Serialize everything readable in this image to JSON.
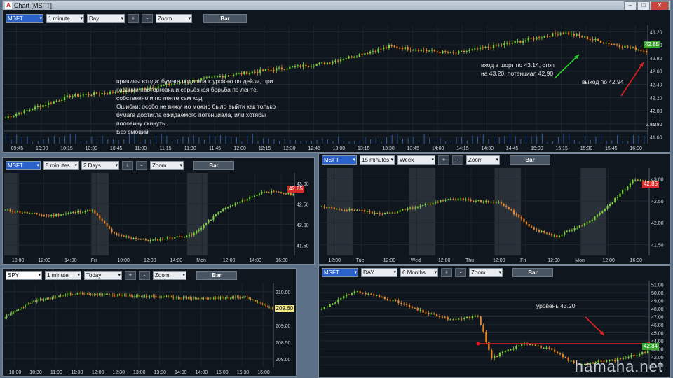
{
  "main": {
    "title": "Chart [MSFT]",
    "symbol": "MSFT",
    "interval": "1 minute",
    "range": "Day",
    "zoom": "Zoom",
    "bar_label": "Bar",
    "plus": "+",
    "minus": "-",
    "price_badge": "42.85",
    "volume_label": "2.8M",
    "y_ticks": [
      "43.20",
      "43.00",
      "42.80",
      "42.60",
      "42.40",
      "42.20",
      "42.00",
      "41.80",
      "41.60"
    ],
    "x_ticks": [
      "09:45",
      "10:00",
      "10:15",
      "10:30",
      "10:45",
      "11:00",
      "11:15",
      "11:30",
      "11:45",
      "12:00",
      "12:15",
      "12:30",
      "12:45",
      "13:00",
      "13:15",
      "13:30",
      "13:45",
      "14:00",
      "14:15",
      "14:30",
      "14:45",
      "15:00",
      "15:15",
      "15:30",
      "15:45",
      "16:00"
    ],
    "annotation_reasons": "причины входа: бумага подошла к уровню по дейли, при\nкасании проторговка и серьёзная борьба по ленте,\nсобственно и по ленте сам ход\nОшибки: особо не вижу, но можно было выйти как только\nбумага достигла ожидаемого потенциала, или хотябы\nполовину скинуть.\nБез эмоций",
    "annotation_entry": "вход в шорт по 43.14, стоп\nна 43.20, потенциал 42.90",
    "annotation_exit": "выход по 42.94",
    "colors": {
      "entry_arrow": "#2bd12b",
      "exit_arrow": "#e02020",
      "up": "#7bd23a",
      "down": "#e8862a"
    }
  },
  "chart_5min": {
    "symbol": "MSFT",
    "interval": "5 minutes",
    "range": "2 Days",
    "zoom": "Zoom",
    "bar_label": "Bar",
    "plus": "+",
    "minus": "-",
    "price_badge": "42.85",
    "y_ticks": [
      "43.00",
      "42.50",
      "42.00",
      "41.50"
    ],
    "x_ticks": [
      "10:00",
      "12:00",
      "14:00",
      "Fri",
      "10:00",
      "12:00",
      "14:00",
      "Mon",
      "12:00",
      "14:00",
      "16:00"
    ]
  },
  "chart_15min": {
    "symbol": "MSFT",
    "interval": "15 minutes",
    "range": "Week",
    "zoom": "Zoom",
    "bar_label": "Bar",
    "plus": "+",
    "minus": "-",
    "price_badge": "42.85",
    "y_ticks": [
      "43.00",
      "42.50",
      "42.00",
      "41.50"
    ],
    "x_ticks": [
      "12:00",
      "Tue",
      "12:00",
      "Wed",
      "12:00",
      "Thu",
      "12:00",
      "Fri",
      "12:00",
      "Mon",
      "12:00",
      "16:00"
    ]
  },
  "chart_spy": {
    "symbol": "SPY",
    "interval": "1 minute",
    "range": "Today",
    "zoom": "Zoom",
    "bar_label": "Bar",
    "plus": "+",
    "minus": "-",
    "price_badge": "209.60",
    "y_ticks": [
      "210.00",
      "209.50",
      "209.00",
      "208.50",
      "208.00"
    ],
    "x_ticks": [
      "10:00",
      "10:30",
      "11:00",
      "11:30",
      "12:00",
      "12:30",
      "13:00",
      "13:30",
      "14:00",
      "14:30",
      "15:00",
      "15:30",
      "16:00"
    ]
  },
  "chart_daily": {
    "symbol": "MSFT",
    "interval": "DAY",
    "range": "6 Months",
    "zoom": "Zoom",
    "bar_label": "Bar",
    "plus": "+",
    "minus": "-",
    "price_badge": "42.84",
    "level_label": "уровень 43.20",
    "y_ticks": [
      "51.00",
      "50.00",
      "49.00",
      "48.00",
      "47.00",
      "46.00",
      "45.00",
      "44.00",
      "43.00",
      "42.00",
      "41.00"
    ],
    "watermark": "hamaha.net"
  }
}
